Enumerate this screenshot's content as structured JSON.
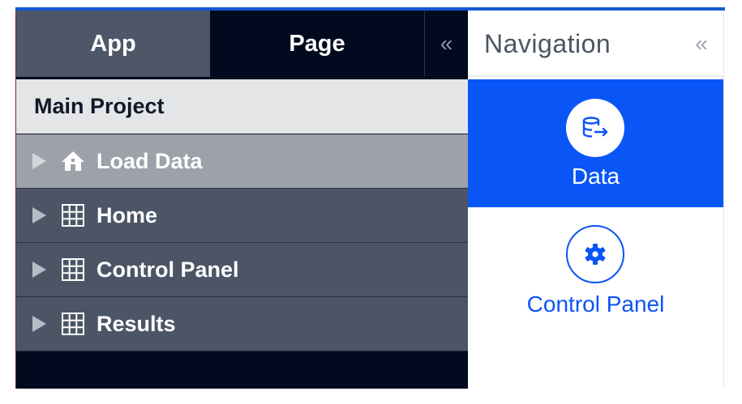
{
  "left_panel": {
    "tabs": [
      {
        "label": "App",
        "active": true
      },
      {
        "label": "Page",
        "active": false
      }
    ],
    "collapse_glyph": "«",
    "project": {
      "title": "Main Project"
    },
    "tree_items": [
      {
        "label": "Load Data",
        "icon": "home-icon",
        "active": true
      },
      {
        "label": "Home",
        "icon": "table-grid-icon",
        "active": false
      },
      {
        "label": "Control Panel",
        "icon": "table-grid-icon",
        "active": false
      },
      {
        "label": "Results",
        "icon": "table-grid-icon",
        "active": false
      }
    ]
  },
  "navigation": {
    "title": "Navigation",
    "collapse_glyph": "«",
    "items": [
      {
        "label": "Data",
        "icon": "database-export-icon",
        "active": true
      },
      {
        "label": "Control Panel",
        "icon": "gear-icon",
        "active": false
      }
    ]
  },
  "colors": {
    "accent": "#0a55f6",
    "top_bar": "#1559d6",
    "sidebar_dark": "#020a1f",
    "tab_active": "#4d5767",
    "tree_item": "#4b5566",
    "tree_item_active": "#9da2aa"
  }
}
